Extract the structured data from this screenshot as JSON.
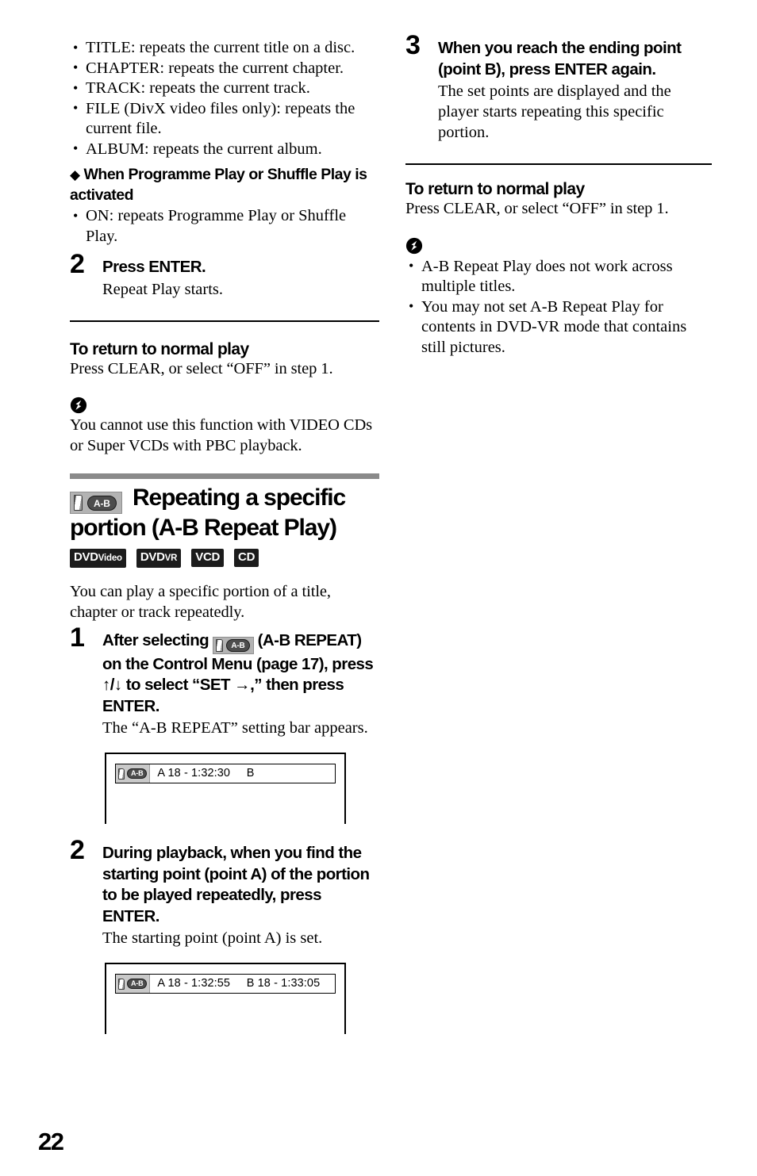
{
  "page": {
    "number": "22"
  },
  "left_column": {
    "repeat_options": [
      "TITLE: repeats the current title on a disc.",
      "CHAPTER: repeats the current chapter.",
      "TRACK: repeats the current track.",
      "FILE (DivX video files only): repeats the current file.",
      "ALBUM: repeats the current album."
    ],
    "diamond_heading": "When Programme Play or Shuffle Play is activated",
    "programme_options": [
      "ON: repeats Programme Play or Shuffle Play."
    ],
    "step2": {
      "number": "2",
      "title": "Press ENTER.",
      "desc": "Repeat Play starts."
    },
    "return_section": {
      "heading": "To return to normal play",
      "text": "Press CLEAR, or select “OFF” in step 1."
    },
    "note": {
      "icon": "note-bolt-icon",
      "text": "You cannot use this function with VIDEO CDs or Super VCDs with PBC playback."
    },
    "section": {
      "icon_label": "A-B",
      "title_line1": "Repeating a specific",
      "title_line2": "portion (A-B Repeat Play)",
      "disc_badges": [
        {
          "main": "DVD",
          "suffix": "Video"
        },
        {
          "main": "DVD",
          "suffix": "VR"
        },
        {
          "main": "VCD",
          "suffix": ""
        },
        {
          "main": "CD",
          "suffix": ""
        }
      ],
      "intro": "You can play a specific portion of a title, chapter or track repeatedly."
    },
    "step1": {
      "number": "1",
      "title_before_icon": "After selecting",
      "icon_label": "A-B",
      "title_after_icon": "(A-B REPEAT) on the Control Menu (page 17), press ↑/↓ to select “SET →,” then press ENTER.",
      "desc": "The “A-B REPEAT” setting bar appears."
    },
    "screenshot1": {
      "icon_label": "A-B",
      "bar_text": "A 18 - 1:32:30     B"
    },
    "step2b": {
      "number": "2",
      "title": "During playback, when you find the starting point (point A) of the portion to be played repeatedly, press ENTER.",
      "desc": "The starting point (point A) is set."
    },
    "screenshot2": {
      "icon_label": "A-B",
      "bar_text": "A 18 - 1:32:55     B 18 - 1:33:05"
    }
  },
  "right_column": {
    "step3": {
      "number": "3",
      "title": "When you reach the ending point (point B), press ENTER again.",
      "desc": "The set points are displayed and the player starts repeating this specific portion."
    },
    "return_section": {
      "heading": "To return to normal play",
      "text": "Press CLEAR, or select “OFF” in step 1."
    },
    "note": {
      "icon": "note-bolt-icon",
      "items": [
        "A-B Repeat Play does not work across multiple titles.",
        "You may not set A-B Repeat Play for contents in DVD-VR mode that contains still pictures."
      ]
    }
  }
}
